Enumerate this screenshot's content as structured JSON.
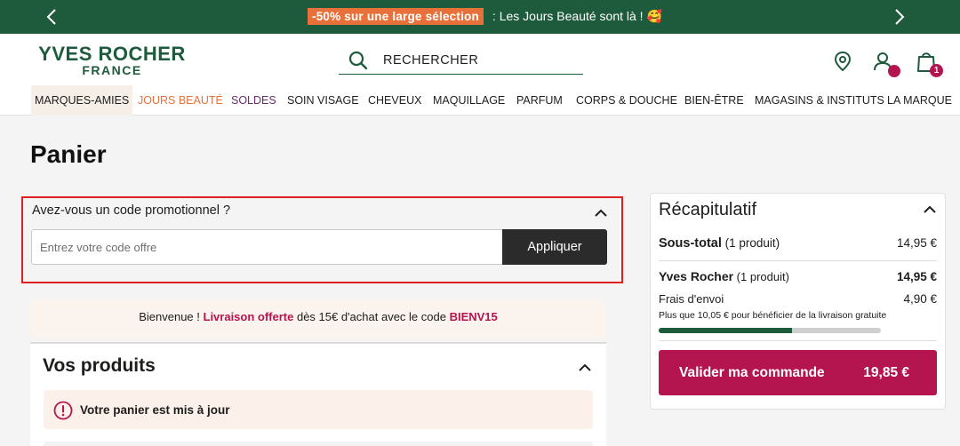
{
  "promo_bar": {
    "badge": "-50% sur une large sélection",
    "text": ": Les Jours Beauté sont là ! 🥰",
    "colors": {
      "background": "#1e5a3c",
      "badge": "#e8703a"
    }
  },
  "header": {
    "logo_main": "YVES ROCHER",
    "logo_sub": "FRANCE",
    "search_label": "RECHERCHER",
    "cart_count": "1",
    "icons": [
      "store-locator-icon",
      "account-icon",
      "shopping-bag-icon"
    ]
  },
  "nav": {
    "items": [
      "MARQUES-AMIES",
      "JOURS BEAUTÉ",
      "SOLDES",
      "SOIN VISAGE",
      "CHEVEUX",
      "MAQUILLAGE",
      "PARFUM",
      "CORPS & DOUCHE",
      "BIEN-ÊTRE",
      "MAGASINS & INSTITUTS",
      "LA MARQUE"
    ]
  },
  "page": {
    "title": "Panier"
  },
  "promo_code": {
    "question": "Avez-vous un code promotionnel ?",
    "placeholder": "Entrez votre code offre",
    "value": "",
    "apply_label": "Appliquer"
  },
  "welcome": {
    "prefix": "Bienvenue ! ",
    "highlight": "Livraison offerte",
    "middle": " dès 15€ d'achat avec le code ",
    "code": "BIENV15"
  },
  "products": {
    "title": "Vos produits",
    "alert": "Votre panier est mis à jour"
  },
  "summary": {
    "title": "Récapitulatif",
    "subtotal_label": "Sous-total",
    "subtotal_count": " (1 produit)",
    "subtotal_value": "14,95 €",
    "brand_label": "Yves Rocher",
    "brand_count": " (1 produit)",
    "brand_value": "14,95 €",
    "shipping_label": "Frais d'envoi",
    "shipping_value": "4,90 €",
    "free_shipping_note": "Plus que 10,05 € pour bénéficier de la livraison gratuite",
    "free_shipping_progress": 0.6,
    "checkout_label": "Valider ma commande",
    "checkout_total": "19,85 €"
  },
  "colors": {
    "brand_green": "#1e5a3c",
    "accent_magenta": "#b5154f",
    "highlight_red_border": "#e02020"
  }
}
